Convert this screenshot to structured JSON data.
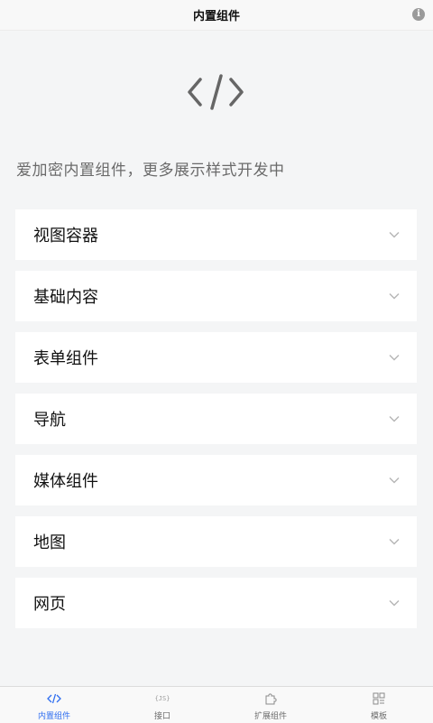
{
  "navbar": {
    "title": "内置组件",
    "info_glyph": "i"
  },
  "hero": {
    "logo_icon": "code-brackets-icon",
    "description": "爱加密内置组件，更多展示样式开发中"
  },
  "panels": [
    {
      "label": "视图容器",
      "expanded": false
    },
    {
      "label": "基础内容",
      "expanded": false
    },
    {
      "label": "表单组件",
      "expanded": false
    },
    {
      "label": "导航",
      "expanded": false
    },
    {
      "label": "媒体组件",
      "expanded": false
    },
    {
      "label": "地图",
      "expanded": false
    },
    {
      "label": "网页",
      "expanded": false
    }
  ],
  "tabbar": {
    "active_color": "#2f6ef0",
    "tabs": [
      {
        "label": "内置组件",
        "icon": "code-icon",
        "active": true
      },
      {
        "label": "接口",
        "icon": "js-icon",
        "icon_text": "{JS}",
        "active": false
      },
      {
        "label": "扩展组件",
        "icon": "puzzle-icon",
        "active": false
      },
      {
        "label": "模板",
        "icon": "template-grid-icon",
        "active": false
      }
    ]
  }
}
